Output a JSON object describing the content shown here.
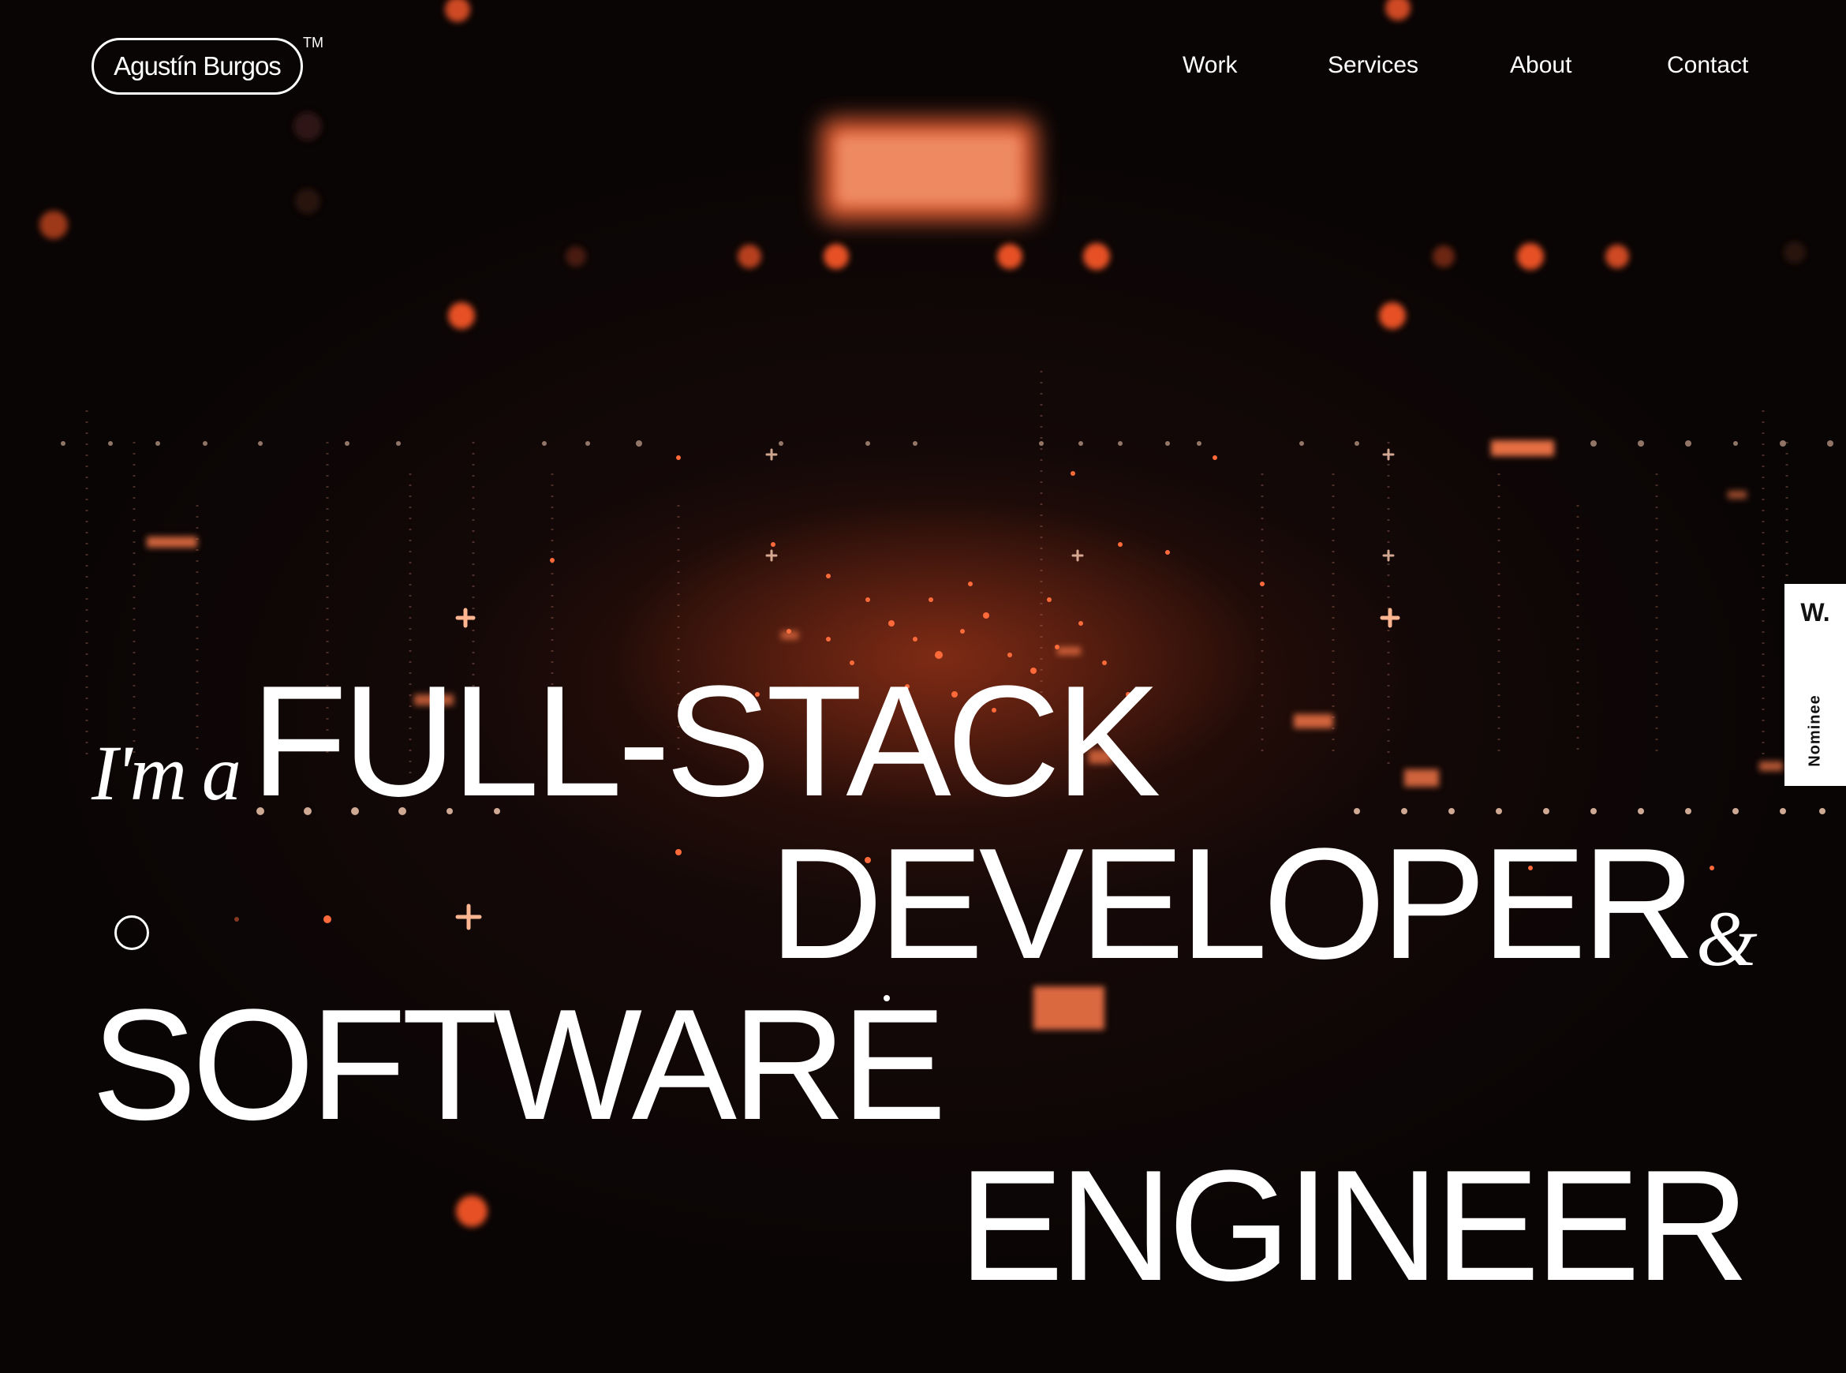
{
  "header": {
    "logo_text": "Agustín Burgos",
    "logo_mark": "TM",
    "nav": [
      "Work",
      "Services",
      "About",
      "Contact"
    ]
  },
  "hero": {
    "prefix": "I'm a",
    "line1": "FULL-STACK",
    "line2": "DEVELOPER",
    "ampersand": "&",
    "line3": "SOFTWARE",
    "line4": "ENGINEER"
  },
  "award_badge": {
    "mark": "W.",
    "label": "Nominee"
  },
  "colors": {
    "background": "#0b0606",
    "accent_glow": "#ff5a2a",
    "text": "#ffffff"
  }
}
